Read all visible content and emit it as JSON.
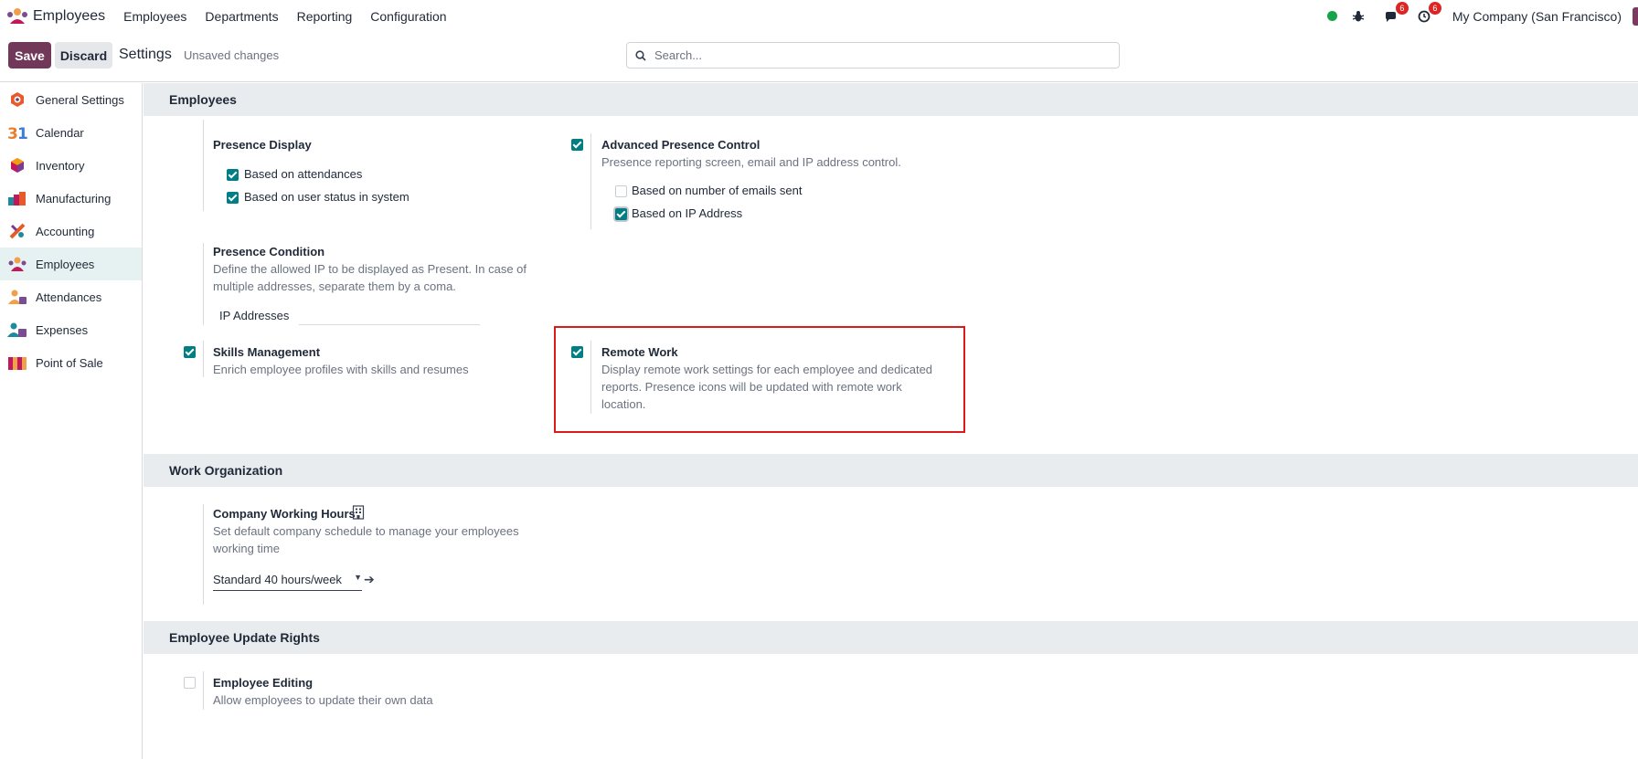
{
  "navbar": {
    "app_name": "Employees",
    "menu": [
      "Employees",
      "Departments",
      "Reporting",
      "Configuration"
    ],
    "messages_badge": "6",
    "activities_badge": "6",
    "company": "My Company (San Francisco)",
    "status_color": "#16a34a"
  },
  "control_panel": {
    "save_label": "Save",
    "discard_label": "Discard",
    "title": "Settings",
    "status": "Unsaved changes",
    "search_placeholder": "Search..."
  },
  "sidebar": {
    "items": [
      {
        "label": "General Settings",
        "icon": "general-settings-icon"
      },
      {
        "label": "Calendar",
        "icon": "calendar-icon"
      },
      {
        "label": "Inventory",
        "icon": "inventory-icon"
      },
      {
        "label": "Manufacturing",
        "icon": "manufacturing-icon"
      },
      {
        "label": "Accounting",
        "icon": "accounting-icon"
      },
      {
        "label": "Employees",
        "icon": "employees-icon",
        "active": true
      },
      {
        "label": "Attendances",
        "icon": "attendances-icon"
      },
      {
        "label": "Expenses",
        "icon": "expenses-icon"
      },
      {
        "label": "Point of Sale",
        "icon": "point-of-sale-icon"
      }
    ]
  },
  "sections": {
    "employees": {
      "title": "Employees",
      "presence_display": {
        "title": "Presence Display",
        "options": [
          {
            "label": "Based on attendances",
            "checked": true
          },
          {
            "label": "Based on user status in system",
            "checked": true
          }
        ]
      },
      "advanced_presence": {
        "title": "Advanced Presence Control",
        "checked": true,
        "desc": "Presence reporting screen, email and IP address control.",
        "options": [
          {
            "label": "Based on number of emails sent",
            "checked": false
          },
          {
            "label": "Based on IP Address",
            "checked": true
          }
        ]
      },
      "presence_condition": {
        "title": "Presence Condition",
        "desc_line1": "Define the allowed IP to be displayed as Present. In case of",
        "desc_line2": "multiple addresses, separate them by a coma.",
        "field_label": "IP Addresses"
      },
      "skills": {
        "title": "Skills Management",
        "checked": true,
        "desc": "Enrich employee profiles with skills and resumes"
      },
      "remote_work": {
        "title": "Remote Work",
        "checked": true,
        "desc_line1": "Display remote work settings for each employee and dedicated",
        "desc_line2": "reports. Presence icons will be updated with remote work",
        "desc_line3": "location."
      }
    },
    "work_organization": {
      "title": "Work Organization",
      "working_hours": {
        "title": "Company Working Hours",
        "desc_line1": "Set default company schedule to manage your employees",
        "desc_line2": "working time",
        "value": "Standard 40 hours/week"
      }
    },
    "update_rights": {
      "title": "Employee Update Rights",
      "editing": {
        "title": "Employee Editing",
        "checked": false,
        "desc": "Allow employees to update their own data"
      }
    }
  }
}
